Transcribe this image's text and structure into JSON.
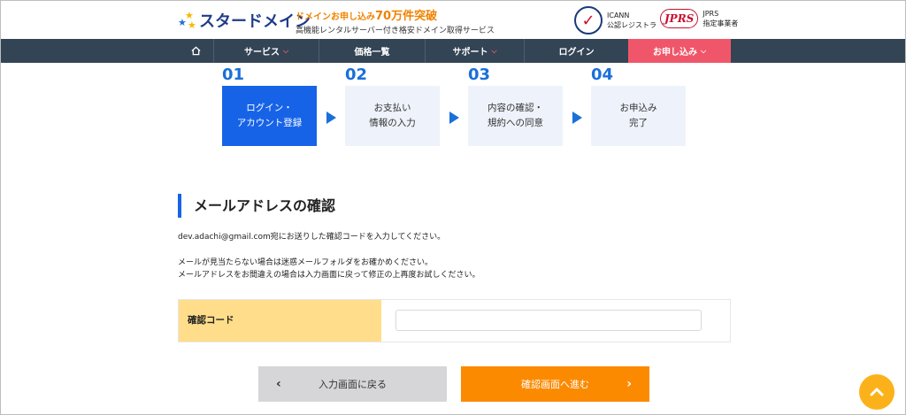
{
  "header": {
    "logo_text": "スタードメイン",
    "tagline_prefix": "ドメインお申し込み",
    "tagline_count": "70万件突破",
    "tagline_sub": "高機能レンタルサーバー付き格安ドメイン取得サービス",
    "icann_name": "ICANN",
    "icann_desc": "公認レジストラ",
    "jprs_logo": "JPRS",
    "jprs_name": "JPRS",
    "jprs_desc": "指定事業者"
  },
  "nav": {
    "home_icon": "home-icon",
    "items": [
      {
        "label": "サービス",
        "has_dropdown": true
      },
      {
        "label": "価格一覧",
        "has_dropdown": false
      },
      {
        "label": "サポート",
        "has_dropdown": true
      },
      {
        "label": "ログイン",
        "has_dropdown": false
      },
      {
        "label": "お申し込み",
        "has_dropdown": true
      }
    ]
  },
  "steps": [
    {
      "num": "01",
      "line1": "ログイン・",
      "line2": "アカウント登録",
      "active": true
    },
    {
      "num": "02",
      "line1": "お支払い",
      "line2": "情報の入力",
      "active": false
    },
    {
      "num": "03",
      "line1": "内容の確認・",
      "line2": "規約への同意",
      "active": false
    },
    {
      "num": "04",
      "line1": "お申込み",
      "line2": "完了",
      "active": false
    }
  ],
  "section": {
    "title": "メールアドレスの確認",
    "message1": "dev.adachi@gmail.com宛にお送りした確認コードを入力してください。",
    "message2": "メールが見当たらない場合は迷惑メールフォルダをお確かめください。",
    "message3": "メールアドレスをお間違えの場合は入力画面に戻って修正の上再度お試しください。"
  },
  "form": {
    "code_label": "確認コード",
    "code_value": "",
    "code_placeholder": ""
  },
  "buttons": {
    "back_label": "入力画面に戻る",
    "next_label": "確認画面へ進む"
  },
  "colors": {
    "nav_bg": "#334455",
    "accent_blue": "#1763e8",
    "apply_pink": "#f0566a",
    "next_orange": "#fc8a00",
    "label_yellow": "#ffdd8a",
    "to_top": "#fbb21a"
  }
}
